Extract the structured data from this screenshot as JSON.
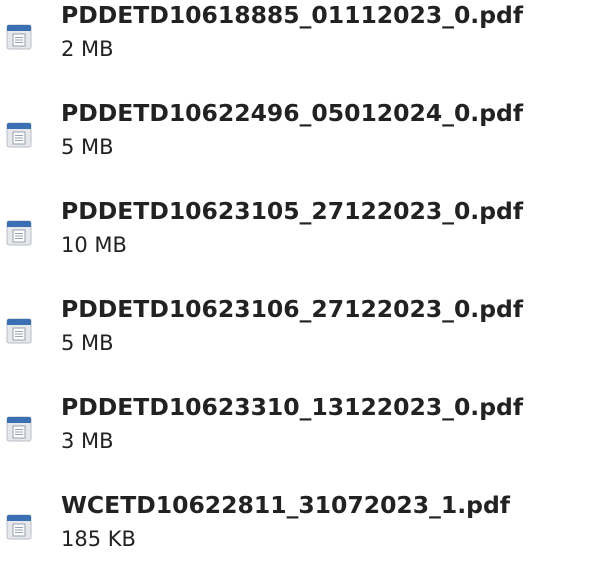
{
  "files": [
    {
      "name": "PDDETD10618885_01112023_0.pdf",
      "size": "2 MB",
      "icon": "document-icon"
    },
    {
      "name": "PDDETD10622496_05012024_0.pdf",
      "size": "5 MB",
      "icon": "document-icon"
    },
    {
      "name": "PDDETD10623105_27122023_0.pdf",
      "size": "10 MB",
      "icon": "document-icon"
    },
    {
      "name": "PDDETD10623106_27122023_0.pdf",
      "size": "5 MB",
      "icon": "document-icon"
    },
    {
      "name": "PDDETD10623310_13122023_0.pdf",
      "size": "3 MB",
      "icon": "document-icon"
    },
    {
      "name": "WCETD10622811_31072023_1.pdf",
      "size": "185 KB",
      "icon": "document-icon"
    }
  ],
  "colors": {
    "icon_header": "#3a6fb4",
    "icon_body": "#e6e8ec",
    "icon_lines": "#9aa2ad",
    "text": "#222222"
  }
}
